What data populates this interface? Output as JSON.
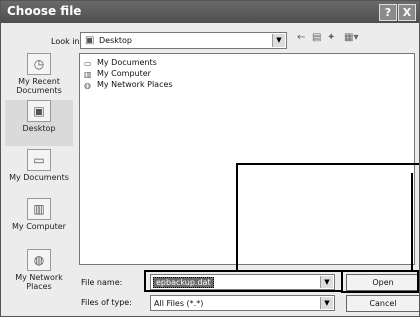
{
  "window": {
    "title": "Choose file",
    "help_label": "?",
    "close_label": "X"
  },
  "toolbar": {
    "look_in_label": "Look in:",
    "look_in_value": "Desktop",
    "tool_icons": [
      "back-arrow-icon",
      "up-folder-icon",
      "new-folder-icon",
      "views-menu-icon"
    ]
  },
  "places": [
    {
      "label": "My Recent Documents"
    },
    {
      "label": "Desktop"
    },
    {
      "label": "My Documents"
    },
    {
      "label": "My Computer"
    },
    {
      "label": "My Network Places"
    }
  ],
  "files": [
    {
      "name": "My Documents",
      "icon": "documents-folder-icon"
    },
    {
      "name": "My Computer",
      "icon": "computer-icon"
    },
    {
      "name": "My Network Places",
      "icon": "network-places-icon"
    }
  ],
  "fields": {
    "file_name_label": "File name:",
    "file_name_value": "epbackup.dat",
    "files_of_type_label": "Files of type:",
    "files_of_type_value": "All Files (*.*)"
  },
  "buttons": {
    "open": "Open",
    "cancel": "Cancel"
  },
  "colors": {
    "titlebar": "#5a5a5a",
    "dialog_bg": "#ececec"
  }
}
